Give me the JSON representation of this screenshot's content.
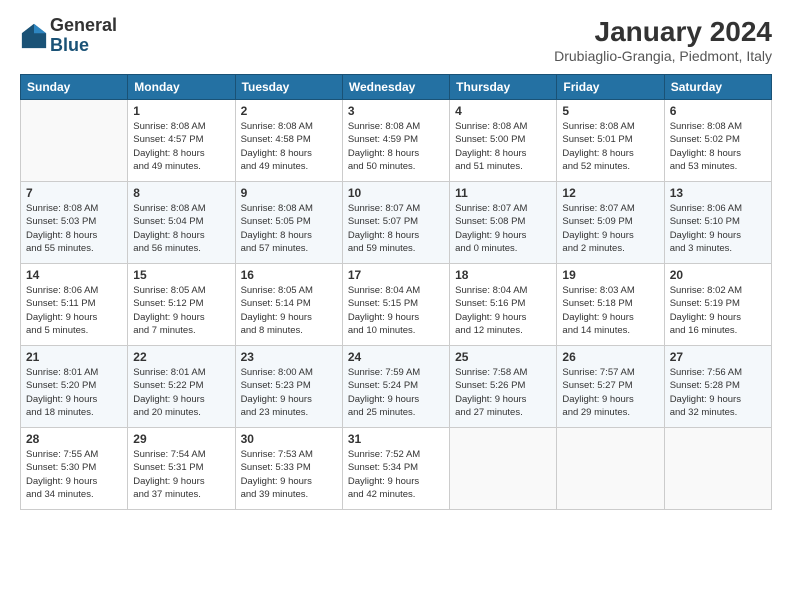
{
  "logo": {
    "general": "General",
    "blue": "Blue"
  },
  "title": "January 2024",
  "location": "Drubiaglio-Grangia, Piedmont, Italy",
  "days_of_week": [
    "Sunday",
    "Monday",
    "Tuesday",
    "Wednesday",
    "Thursday",
    "Friday",
    "Saturday"
  ],
  "weeks": [
    [
      {
        "day": "",
        "info": ""
      },
      {
        "day": "1",
        "info": "Sunrise: 8:08 AM\nSunset: 4:57 PM\nDaylight: 8 hours\nand 49 minutes."
      },
      {
        "day": "2",
        "info": "Sunrise: 8:08 AM\nSunset: 4:58 PM\nDaylight: 8 hours\nand 49 minutes."
      },
      {
        "day": "3",
        "info": "Sunrise: 8:08 AM\nSunset: 4:59 PM\nDaylight: 8 hours\nand 50 minutes."
      },
      {
        "day": "4",
        "info": "Sunrise: 8:08 AM\nSunset: 5:00 PM\nDaylight: 8 hours\nand 51 minutes."
      },
      {
        "day": "5",
        "info": "Sunrise: 8:08 AM\nSunset: 5:01 PM\nDaylight: 8 hours\nand 52 minutes."
      },
      {
        "day": "6",
        "info": "Sunrise: 8:08 AM\nSunset: 5:02 PM\nDaylight: 8 hours\nand 53 minutes."
      }
    ],
    [
      {
        "day": "7",
        "info": "Sunrise: 8:08 AM\nSunset: 5:03 PM\nDaylight: 8 hours\nand 55 minutes."
      },
      {
        "day": "8",
        "info": "Sunrise: 8:08 AM\nSunset: 5:04 PM\nDaylight: 8 hours\nand 56 minutes."
      },
      {
        "day": "9",
        "info": "Sunrise: 8:08 AM\nSunset: 5:05 PM\nDaylight: 8 hours\nand 57 minutes."
      },
      {
        "day": "10",
        "info": "Sunrise: 8:07 AM\nSunset: 5:07 PM\nDaylight: 8 hours\nand 59 minutes."
      },
      {
        "day": "11",
        "info": "Sunrise: 8:07 AM\nSunset: 5:08 PM\nDaylight: 9 hours\nand 0 minutes."
      },
      {
        "day": "12",
        "info": "Sunrise: 8:07 AM\nSunset: 5:09 PM\nDaylight: 9 hours\nand 2 minutes."
      },
      {
        "day": "13",
        "info": "Sunrise: 8:06 AM\nSunset: 5:10 PM\nDaylight: 9 hours\nand 3 minutes."
      }
    ],
    [
      {
        "day": "14",
        "info": "Sunrise: 8:06 AM\nSunset: 5:11 PM\nDaylight: 9 hours\nand 5 minutes."
      },
      {
        "day": "15",
        "info": "Sunrise: 8:05 AM\nSunset: 5:12 PM\nDaylight: 9 hours\nand 7 minutes."
      },
      {
        "day": "16",
        "info": "Sunrise: 8:05 AM\nSunset: 5:14 PM\nDaylight: 9 hours\nand 8 minutes."
      },
      {
        "day": "17",
        "info": "Sunrise: 8:04 AM\nSunset: 5:15 PM\nDaylight: 9 hours\nand 10 minutes."
      },
      {
        "day": "18",
        "info": "Sunrise: 8:04 AM\nSunset: 5:16 PM\nDaylight: 9 hours\nand 12 minutes."
      },
      {
        "day": "19",
        "info": "Sunrise: 8:03 AM\nSunset: 5:18 PM\nDaylight: 9 hours\nand 14 minutes."
      },
      {
        "day": "20",
        "info": "Sunrise: 8:02 AM\nSunset: 5:19 PM\nDaylight: 9 hours\nand 16 minutes."
      }
    ],
    [
      {
        "day": "21",
        "info": "Sunrise: 8:01 AM\nSunset: 5:20 PM\nDaylight: 9 hours\nand 18 minutes."
      },
      {
        "day": "22",
        "info": "Sunrise: 8:01 AM\nSunset: 5:22 PM\nDaylight: 9 hours\nand 20 minutes."
      },
      {
        "day": "23",
        "info": "Sunrise: 8:00 AM\nSunset: 5:23 PM\nDaylight: 9 hours\nand 23 minutes."
      },
      {
        "day": "24",
        "info": "Sunrise: 7:59 AM\nSunset: 5:24 PM\nDaylight: 9 hours\nand 25 minutes."
      },
      {
        "day": "25",
        "info": "Sunrise: 7:58 AM\nSunset: 5:26 PM\nDaylight: 9 hours\nand 27 minutes."
      },
      {
        "day": "26",
        "info": "Sunrise: 7:57 AM\nSunset: 5:27 PM\nDaylight: 9 hours\nand 29 minutes."
      },
      {
        "day": "27",
        "info": "Sunrise: 7:56 AM\nSunset: 5:28 PM\nDaylight: 9 hours\nand 32 minutes."
      }
    ],
    [
      {
        "day": "28",
        "info": "Sunrise: 7:55 AM\nSunset: 5:30 PM\nDaylight: 9 hours\nand 34 minutes."
      },
      {
        "day": "29",
        "info": "Sunrise: 7:54 AM\nSunset: 5:31 PM\nDaylight: 9 hours\nand 37 minutes."
      },
      {
        "day": "30",
        "info": "Sunrise: 7:53 AM\nSunset: 5:33 PM\nDaylight: 9 hours\nand 39 minutes."
      },
      {
        "day": "31",
        "info": "Sunrise: 7:52 AM\nSunset: 5:34 PM\nDaylight: 9 hours\nand 42 minutes."
      },
      {
        "day": "",
        "info": ""
      },
      {
        "day": "",
        "info": ""
      },
      {
        "day": "",
        "info": ""
      }
    ]
  ]
}
